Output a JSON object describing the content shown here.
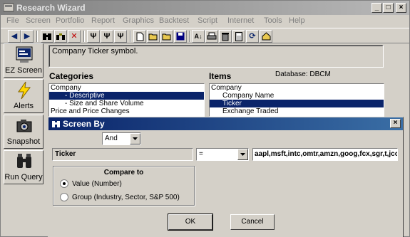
{
  "window": {
    "title": "Research Wizard",
    "minimize": "_",
    "maximize": "□",
    "close": "×"
  },
  "menu": [
    "File",
    "Screen",
    "Portfolio",
    "Report",
    "Graphics",
    "Backtest",
    "Script",
    "Internet",
    "Tools",
    "Help"
  ],
  "sidebar": [
    {
      "label": "EZ Screen",
      "icon": "ez-screen-icon"
    },
    {
      "label": "Alerts",
      "icon": "lightning-icon"
    },
    {
      "label": "Snapshot",
      "icon": "camera-icon"
    },
    {
      "label": "Run Query",
      "icon": "binoculars-icon"
    }
  ],
  "help_text": "Company Ticker symbol.",
  "categories": {
    "heading": "Categories",
    "items": [
      "Company",
      "- Descriptive",
      "- Size and Share Volume",
      "Price and Price Changes"
    ]
  },
  "items_panel": {
    "heading": "Items",
    "database_label": "Database: DBCM",
    "items": [
      "Company",
      "Company Name",
      "Ticker",
      "Exchange Traded"
    ]
  },
  "dialog": {
    "title": "Screen By",
    "logic_value": "And",
    "field_name": "Ticker",
    "operator_value": "=",
    "value_text": "aapl,msft,intc,omtr,amzn,goog,fcx,sgr,t,jcom",
    "compare_to": {
      "label": "Compare to",
      "options": [
        "Value (Number)",
        "Group (Industry, Sector, S&P 500)"
      ],
      "selected_index": 0
    },
    "ok_label": "OK",
    "cancel_label": "Cancel",
    "close": "×"
  },
  "colors": {
    "selection": "#0a246a",
    "title_active": "#0a246a",
    "title_inactive": "#808080"
  }
}
